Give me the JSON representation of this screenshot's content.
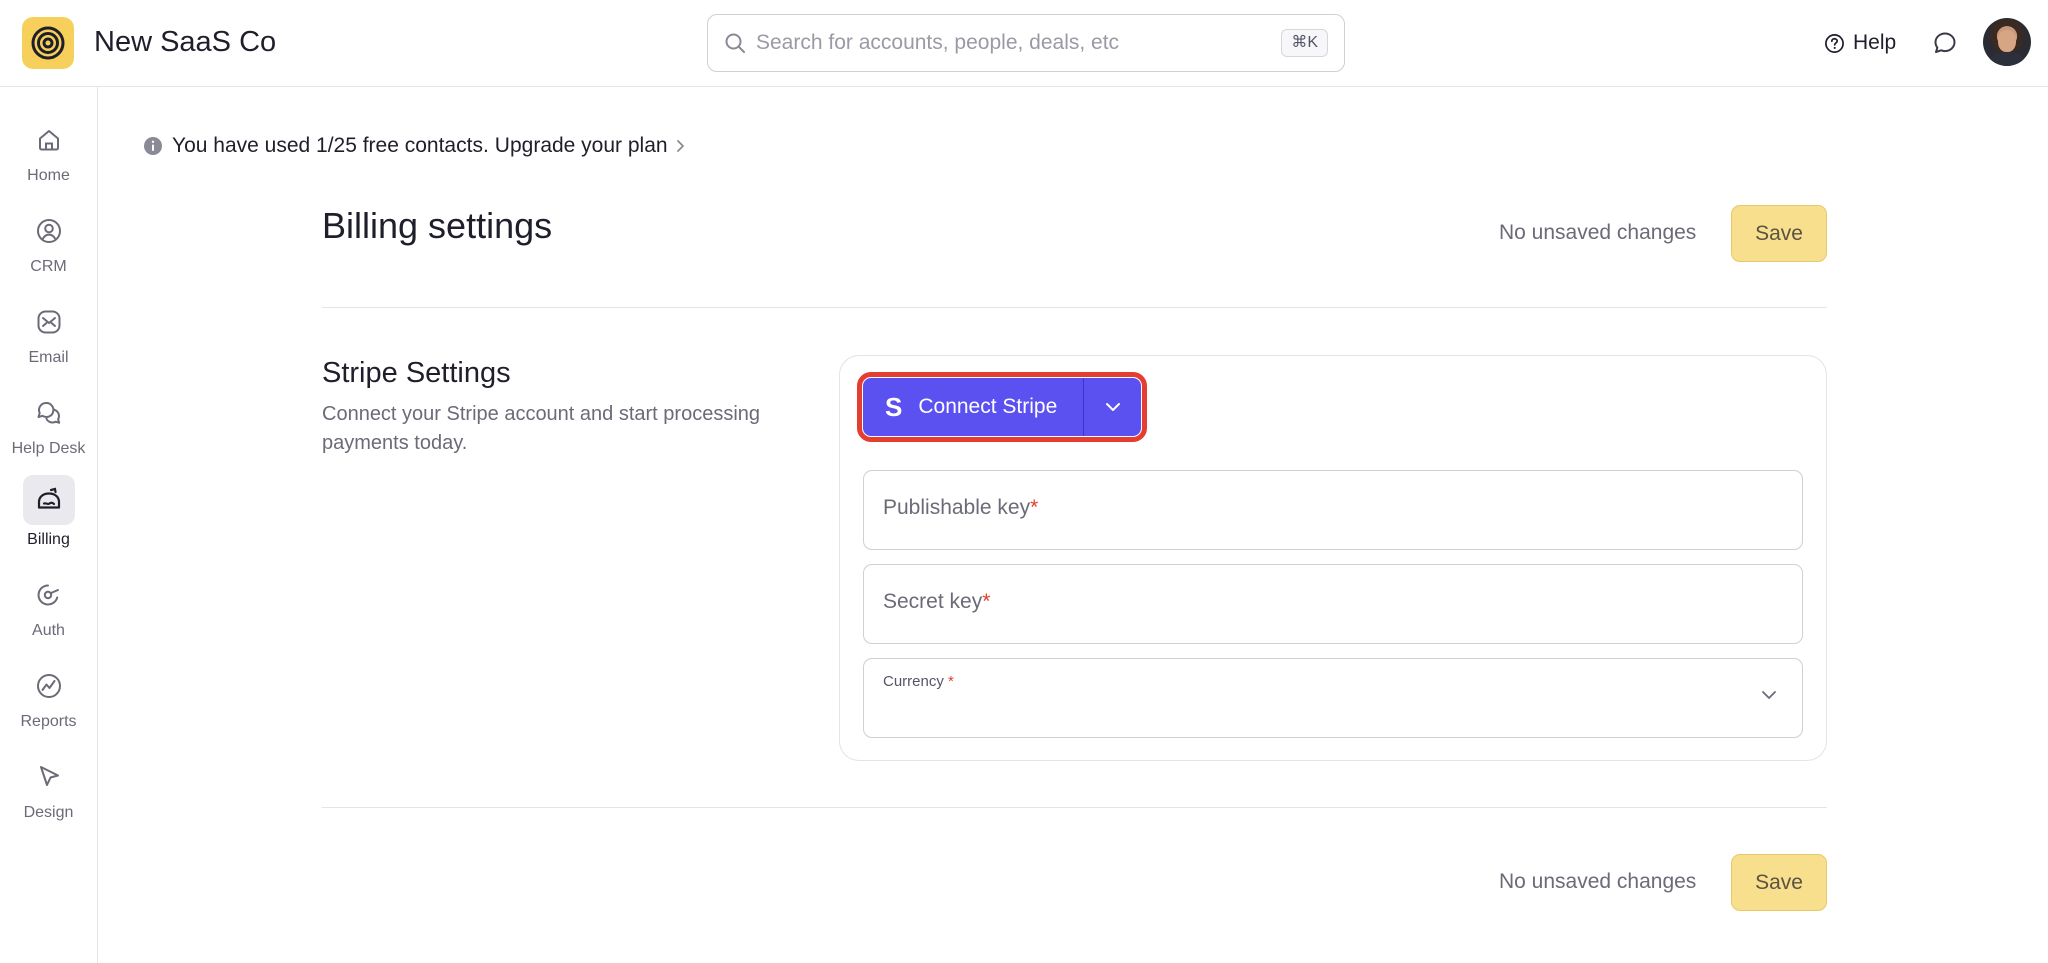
{
  "app": {
    "title": "New SaaS Co"
  },
  "search": {
    "placeholder": "Search for accounts, people, deals, etc",
    "shortcut": "⌘K"
  },
  "header": {
    "help_label": "Help"
  },
  "sidebar": {
    "items": [
      {
        "label": "Home",
        "icon": "home-icon",
        "active": false
      },
      {
        "label": "CRM",
        "icon": "person-circle-icon",
        "active": false
      },
      {
        "label": "Email",
        "icon": "mail-icon",
        "active": false
      },
      {
        "label": "Help Desk",
        "icon": "chat-bubbles-icon",
        "active": false
      },
      {
        "label": "Billing",
        "icon": "billing-icon",
        "active": true
      },
      {
        "label": "Auth",
        "icon": "key-icon",
        "active": false
      },
      {
        "label": "Reports",
        "icon": "chart-line-icon",
        "active": false
      },
      {
        "label": "Design",
        "icon": "cursor-icon",
        "active": false
      }
    ]
  },
  "banner": {
    "text": "You have used 1/25 free contacts.",
    "link": "Upgrade your plan"
  },
  "page": {
    "title": "Billing settings",
    "status": "No unsaved changes",
    "save_label": "Save"
  },
  "stripe": {
    "title": "Stripe Settings",
    "description": "Connect your Stripe account and start processing payments today.",
    "connect_label": "Connect Stripe",
    "connect_icon_letter": "S",
    "publishable_label": "Publishable key",
    "secret_label": "Secret key",
    "currency_label": "Currency",
    "required_mark": "*"
  },
  "footer": {
    "status": "No unsaved changes",
    "save_label": "Save"
  },
  "colors": {
    "brand_yellow": "#f6d05a",
    "save_yellow": "#f7df8e",
    "stripe_purple": "#5b50f0",
    "highlight_red": "#e53d2f"
  }
}
